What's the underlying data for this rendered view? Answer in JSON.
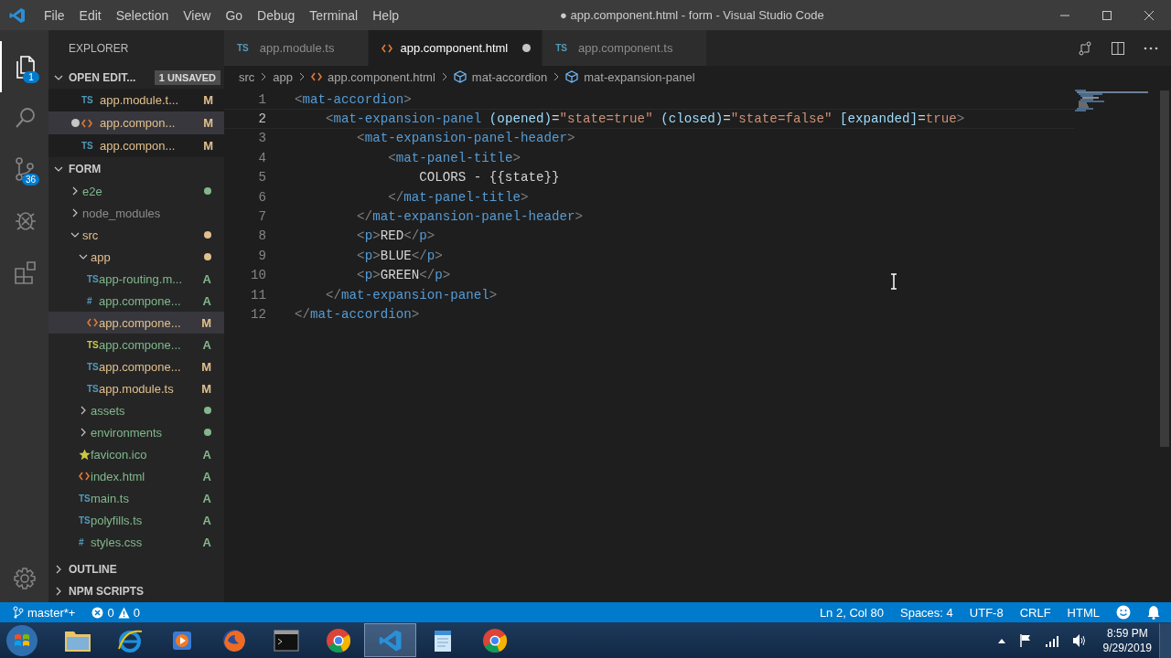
{
  "window": {
    "title": "● app.component.html - form - Visual Studio Code"
  },
  "menu": [
    "File",
    "Edit",
    "Selection",
    "View",
    "Go",
    "Debug",
    "Terminal",
    "Help"
  ],
  "activity_bar": [
    {
      "kind": "files",
      "badge": "1",
      "selected": true
    },
    {
      "kind": "search",
      "selected": false
    },
    {
      "kind": "scm",
      "badge": "36",
      "selected": false
    },
    {
      "kind": "debug",
      "selected": false
    },
    {
      "kind": "extensions",
      "selected": false
    }
  ],
  "sidebar": {
    "title": "EXPLORER",
    "open_editors": {
      "label": "OPEN EDIT...",
      "badge": "1 UNSAVED",
      "expanded": true,
      "items": [
        {
          "kind": "ts",
          "icon_text": "TS",
          "label": "app.module.t...",
          "status": "M",
          "color": "#e2c08d",
          "dirty": false,
          "selected": false
        },
        {
          "kind": "html",
          "label": "app.compon...",
          "status": "M",
          "color": "#e2c08d",
          "dirty": true,
          "selected": true
        },
        {
          "kind": "ts",
          "icon_text": "TS",
          "label": "app.compon...",
          "status": "M",
          "color": "#e2c08d",
          "dirty": false,
          "selected": false
        }
      ]
    },
    "folder": {
      "label": "FORM",
      "expanded": true,
      "items": [
        {
          "kind": "folder",
          "label": "e2e",
          "color": "#81b88b",
          "expanded": false,
          "selected": false
        },
        {
          "kind": "folder",
          "label": "node_modules",
          "color": "#8c8c8c",
          "ignored": true,
          "expanded": false,
          "selected": false
        },
        {
          "kind": "folder",
          "label": "src",
          "color": "#e2c08d",
          "expanded": true,
          "selected": false,
          "children": [
            {
              "kind": "folder",
              "label": "app",
              "color": "#e2c08d",
              "expanded": true,
              "selected": false,
              "children": [
                {
                  "kind": "ts",
                  "icon_text": "TS",
                  "label": "app-routing.m...",
                  "status": "A",
                  "color": "#81b88b",
                  "selected": false
                },
                {
                  "kind": "css",
                  "icon_text": "#",
                  "label": "app.compone...",
                  "status": "A",
                  "color": "#81b88b",
                  "selected": false
                },
                {
                  "kind": "html",
                  "label": "app.compone...",
                  "status": "M",
                  "color": "#e2c08d",
                  "selected": true
                },
                {
                  "kind": "ts-spec",
                  "icon_text": "TS",
                  "label": "app.compone...",
                  "status": "A",
                  "color": "#81b88b",
                  "selected": false
                },
                {
                  "kind": "ts",
                  "icon_text": "TS",
                  "label": "app.compone...",
                  "status": "M",
                  "color": "#e2c08d",
                  "selected": false
                },
                {
                  "kind": "ts",
                  "icon_text": "TS",
                  "label": "app.module.ts",
                  "status": "M",
                  "color": "#e2c08d",
                  "selected": false
                }
              ]
            },
            {
              "kind": "folder",
              "label": "assets",
              "color": "#81b88b",
              "expanded": false,
              "selected": false
            },
            {
              "kind": "folder",
              "label": "environments",
              "color": "#81b88b",
              "expanded": false,
              "selected": false
            },
            {
              "kind": "star",
              "label": "favicon.ico",
              "status": "A",
              "color": "#81b88b",
              "selected": false
            },
            {
              "kind": "html",
              "label": "index.html",
              "status": "A",
              "color": "#81b88b",
              "selected": false
            },
            {
              "kind": "ts",
              "icon_text": "TS",
              "label": "main.ts",
              "status": "A",
              "color": "#81b88b",
              "selected": false
            },
            {
              "kind": "ts",
              "icon_text": "TS",
              "label": "polyfills.ts",
              "status": "A",
              "color": "#81b88b",
              "selected": false
            },
            {
              "kind": "css",
              "icon_text": "#",
              "label": "styles.css",
              "status": "A",
              "color": "#81b88b",
              "selected": false
            }
          ]
        }
      ]
    },
    "sections": [
      {
        "label": "OUTLINE",
        "expanded": false
      },
      {
        "label": "NPM SCRIPTS",
        "expanded": false
      }
    ]
  },
  "tabs": [
    {
      "kind": "ts",
      "icon_text": "TS",
      "label": "app.module.ts",
      "selected": false,
      "dirty": false
    },
    {
      "kind": "html",
      "label": "app.component.html",
      "selected": true,
      "dirty": true
    },
    {
      "kind": "ts",
      "icon_text": "TS",
      "label": "app.component.ts",
      "selected": false,
      "dirty": false
    }
  ],
  "breadcrumbs": [
    {
      "kind": "folder",
      "label": "src"
    },
    {
      "kind": "folder",
      "label": "app"
    },
    {
      "kind": "html",
      "label": "app.component.html"
    },
    {
      "kind": "symbol",
      "label": "mat-accordion"
    },
    {
      "kind": "symbol",
      "label": "mat-expansion-panel"
    }
  ],
  "editor": {
    "lines": [
      {
        "number": "1",
        "current": false,
        "tokens": [
          {
            "kind": "punct",
            "text": "<"
          },
          {
            "kind": "tag",
            "text": "mat-accordion"
          },
          {
            "kind": "punct",
            "text": ">"
          }
        ]
      },
      {
        "number": "2",
        "current": true,
        "tokens": [
          {
            "kind": "punct",
            "text": "    <"
          },
          {
            "kind": "tag",
            "text": "mat-expansion-panel"
          },
          {
            "kind": "attr",
            "text": " (opened)"
          },
          {
            "kind": "text",
            "text": "="
          },
          {
            "kind": "string",
            "text": "\"state=true\""
          },
          {
            "kind": "attr",
            "text": " (closed)"
          },
          {
            "kind": "text",
            "text": "="
          },
          {
            "kind": "string",
            "text": "\"state=false\""
          },
          {
            "kind": "attr",
            "text": " [expanded]"
          },
          {
            "kind": "text",
            "text": "="
          },
          {
            "kind": "string",
            "text": "true"
          },
          {
            "kind": "punct",
            "text": ">"
          }
        ]
      },
      {
        "number": "3",
        "current": false,
        "tokens": [
          {
            "kind": "punct",
            "text": "        <"
          },
          {
            "kind": "tag",
            "text": "mat-expansion-panel-header"
          },
          {
            "kind": "punct",
            "text": ">"
          }
        ]
      },
      {
        "number": "4",
        "current": false,
        "tokens": [
          {
            "kind": "punct",
            "text": "            <"
          },
          {
            "kind": "tag",
            "text": "mat-panel-title"
          },
          {
            "kind": "punct",
            "text": ">"
          }
        ]
      },
      {
        "number": "5",
        "current": false,
        "tokens": [
          {
            "kind": "text",
            "text": "                COLORS - {{state}}"
          }
        ]
      },
      {
        "number": "6",
        "current": false,
        "tokens": [
          {
            "kind": "punct",
            "text": "            </"
          },
          {
            "kind": "tag",
            "text": "mat-panel-title"
          },
          {
            "kind": "punct",
            "text": ">"
          }
        ]
      },
      {
        "number": "7",
        "current": false,
        "tokens": [
          {
            "kind": "punct",
            "text": "        </"
          },
          {
            "kind": "tag",
            "text": "mat-expansion-panel-header"
          },
          {
            "kind": "punct",
            "text": ">"
          }
        ]
      },
      {
        "number": "8",
        "current": false,
        "tokens": [
          {
            "kind": "punct",
            "text": "        <"
          },
          {
            "kind": "tag",
            "text": "p"
          },
          {
            "kind": "punct",
            "text": ">"
          },
          {
            "kind": "text",
            "text": "RED"
          },
          {
            "kind": "punct",
            "text": "</"
          },
          {
            "kind": "tag",
            "text": "p"
          },
          {
            "kind": "punct",
            "text": ">"
          }
        ]
      },
      {
        "number": "9",
        "current": false,
        "tokens": [
          {
            "kind": "punct",
            "text": "        <"
          },
          {
            "kind": "tag",
            "text": "p"
          },
          {
            "kind": "punct",
            "text": ">"
          },
          {
            "kind": "text",
            "text": "BLUE"
          },
          {
            "kind": "punct",
            "text": "</"
          },
          {
            "kind": "tag",
            "text": "p"
          },
          {
            "kind": "punct",
            "text": ">"
          }
        ]
      },
      {
        "number": "10",
        "current": false,
        "tokens": [
          {
            "kind": "punct",
            "text": "        <"
          },
          {
            "kind": "tag",
            "text": "p"
          },
          {
            "kind": "punct",
            "text": ">"
          },
          {
            "kind": "text",
            "text": "GREEN"
          },
          {
            "kind": "punct",
            "text": "</"
          },
          {
            "kind": "tag",
            "text": "p"
          },
          {
            "kind": "punct",
            "text": ">"
          }
        ]
      },
      {
        "number": "11",
        "current": false,
        "tokens": [
          {
            "kind": "punct",
            "text": "    </"
          },
          {
            "kind": "tag",
            "text": "mat-expansion-panel"
          },
          {
            "kind": "punct",
            "text": ">"
          }
        ]
      },
      {
        "number": "12",
        "current": false,
        "tokens": [
          {
            "kind": "punct",
            "text": "</"
          },
          {
            "kind": "tag",
            "text": "mat-accordion"
          },
          {
            "kind": "punct",
            "text": ">"
          }
        ]
      }
    ]
  },
  "status_bar": {
    "branch": "master*+",
    "errors": "0",
    "warnings": "0",
    "right": [
      "Ln 2, Col 80",
      "Spaces: 4",
      "UTF-8",
      "CRLF",
      "HTML"
    ]
  },
  "taskbar": {
    "apps": [
      {
        "kind": "folder",
        "active": false
      },
      {
        "kind": "browser-e",
        "active": false
      },
      {
        "kind": "media",
        "active": false
      },
      {
        "kind": "fox",
        "active": false
      },
      {
        "kind": "terminal",
        "active": false
      },
      {
        "kind": "chrome",
        "active": false
      },
      {
        "kind": "vscode",
        "active": true
      },
      {
        "kind": "notepad",
        "active": false
      },
      {
        "kind": "chrome",
        "active": false
      }
    ],
    "time": "8:59 PM",
    "date": "9/29/2019"
  }
}
